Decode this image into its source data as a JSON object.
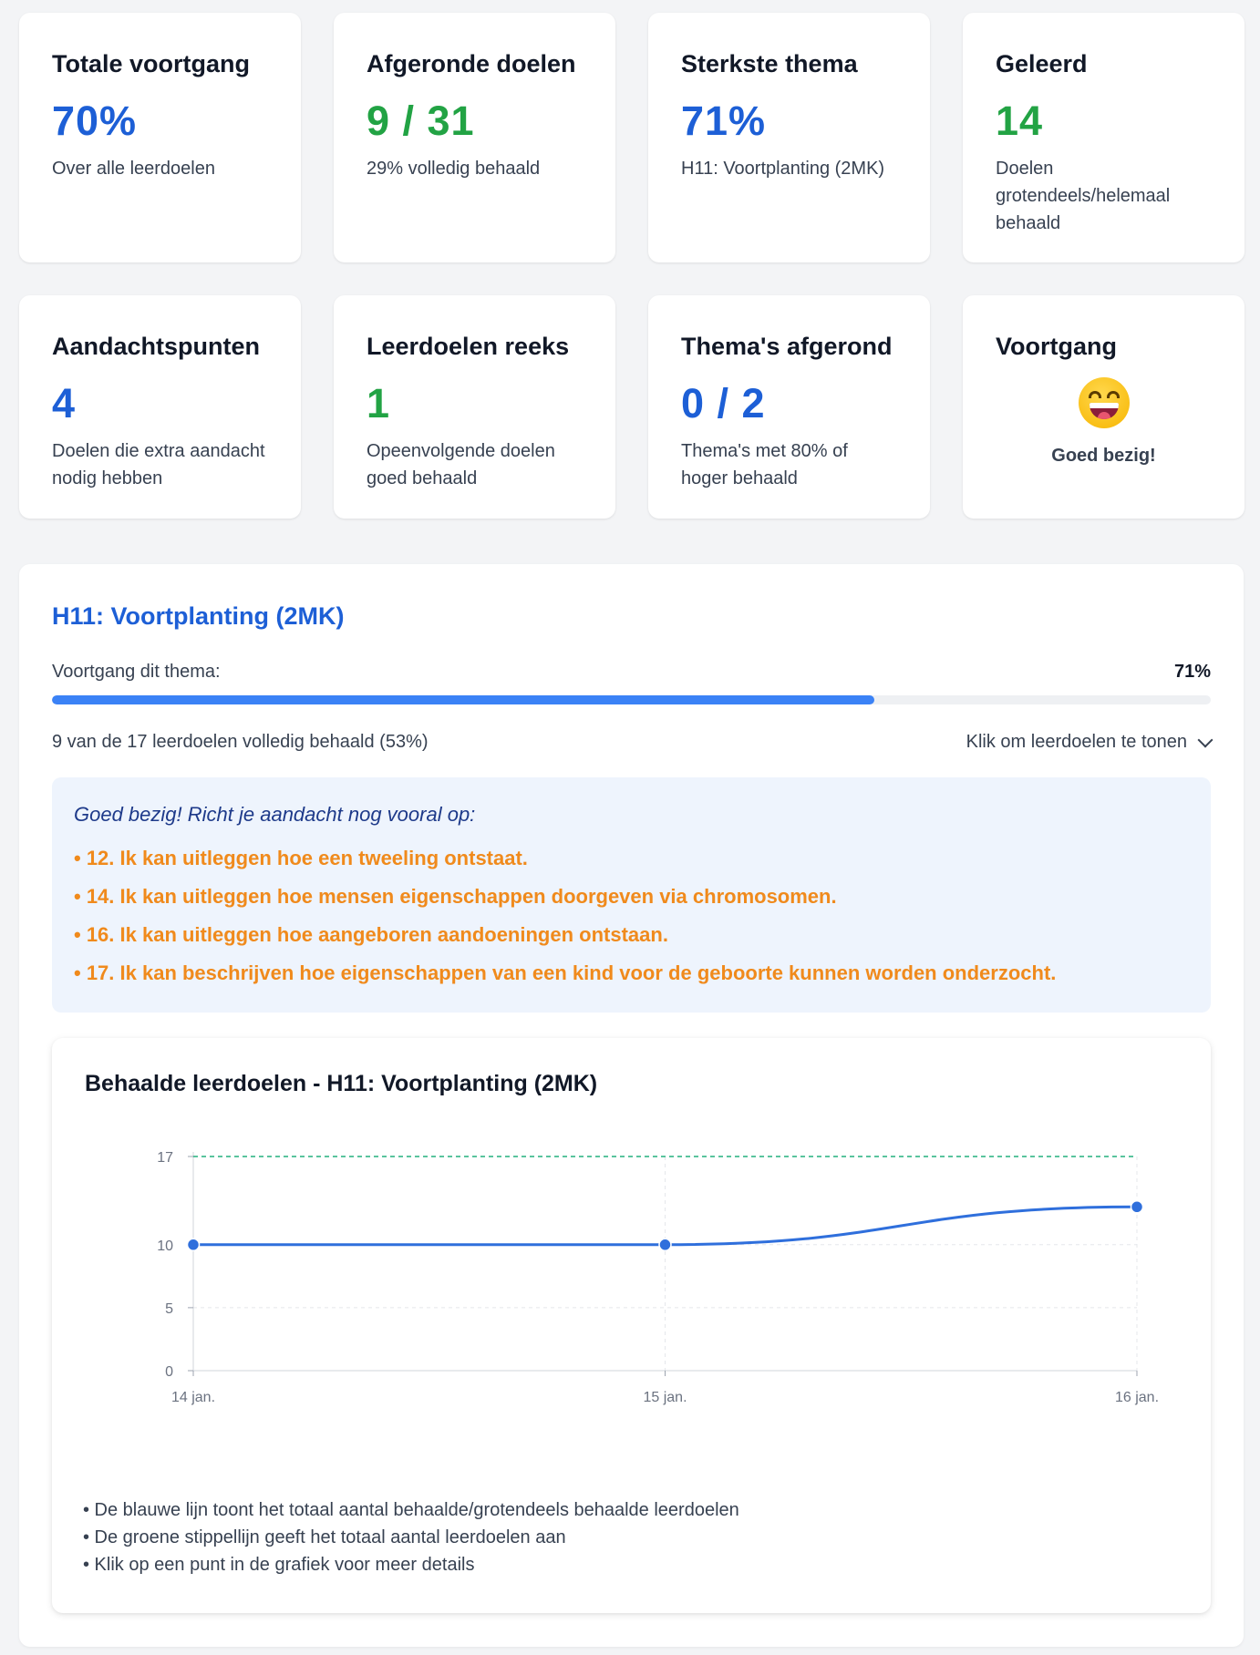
{
  "stats": [
    {
      "title": "Totale voortgang",
      "value": "70%",
      "sub": "Over alle leerdoelen",
      "color": "blue"
    },
    {
      "title": "Afgeronde doelen",
      "value": "9 / 31",
      "sub": "29% volledig behaald",
      "color": "green"
    },
    {
      "title": "Sterkste thema",
      "value": "71%",
      "sub": "H11: Voortplanting (2MK)",
      "color": "blue"
    },
    {
      "title": "Geleerd",
      "value": "14",
      "sub": "Doelen grotendeels/helemaal behaald",
      "color": "green"
    },
    {
      "title": "Aandachtspunten",
      "value": "4",
      "sub": "Doelen die extra aandacht nodig hebben",
      "color": "blue"
    },
    {
      "title": "Leerdoelen reeks",
      "value": "1",
      "sub": "Opeenvolgende doelen goed behaald",
      "color": "green"
    },
    {
      "title": "Thema's afgerond",
      "value": "0 / 2",
      "sub": "Thema's met 80% of hoger behaald",
      "color": "blue"
    }
  ],
  "mood": {
    "title": "Voortgang",
    "emoji": "grinning-face-icon",
    "label": "Goed bezig!"
  },
  "theme": {
    "title": "H11: Voortplanting (2MK)",
    "progress_label": "Voortgang dit thema:",
    "progress_pct": "71%",
    "progress_value": 0.71,
    "summary": "9 van de 17 leerdoelen volledig behaald (53%)",
    "toggle_label": "Klik om leerdoelen te tonen"
  },
  "focus": {
    "heading": "Goed bezig! Richt je aandacht nog vooral op:",
    "items": [
      "• 12. Ik kan uitleggen hoe een tweeling ontstaat.",
      "• 14. Ik kan uitleggen hoe mensen eigenschappen doorgeven via chromosomen.",
      "• 16. Ik kan uitleggen hoe aangeboren aandoeningen ontstaan.",
      "• 17. Ik kan beschrijven hoe eigenschappen van een kind voor de geboorte kunnen worden onderzocht."
    ]
  },
  "chart_data": {
    "type": "line",
    "title": "Behaalde leerdoelen - H11: Voortplanting (2MK)",
    "x": [
      "14 jan.",
      "15 jan.",
      "16 jan."
    ],
    "series": [
      {
        "values": [
          10,
          10,
          13
        ],
        "color": "#2f6fdc"
      }
    ],
    "reference_line": {
      "value": 17,
      "color": "#22b07d",
      "style": "dashed"
    },
    "yticks": [
      0,
      5,
      10,
      17
    ],
    "ylim": [
      0,
      17
    ],
    "grid": true
  },
  "notes": [
    "• De blauwe lijn toont het totaal aantal behaalde/grotendeels behaalde leerdoelen",
    "• De groene stippellijn geeft het totaal aantal leerdoelen aan",
    "• Klik op een punt in de grafiek voor meer details"
  ]
}
